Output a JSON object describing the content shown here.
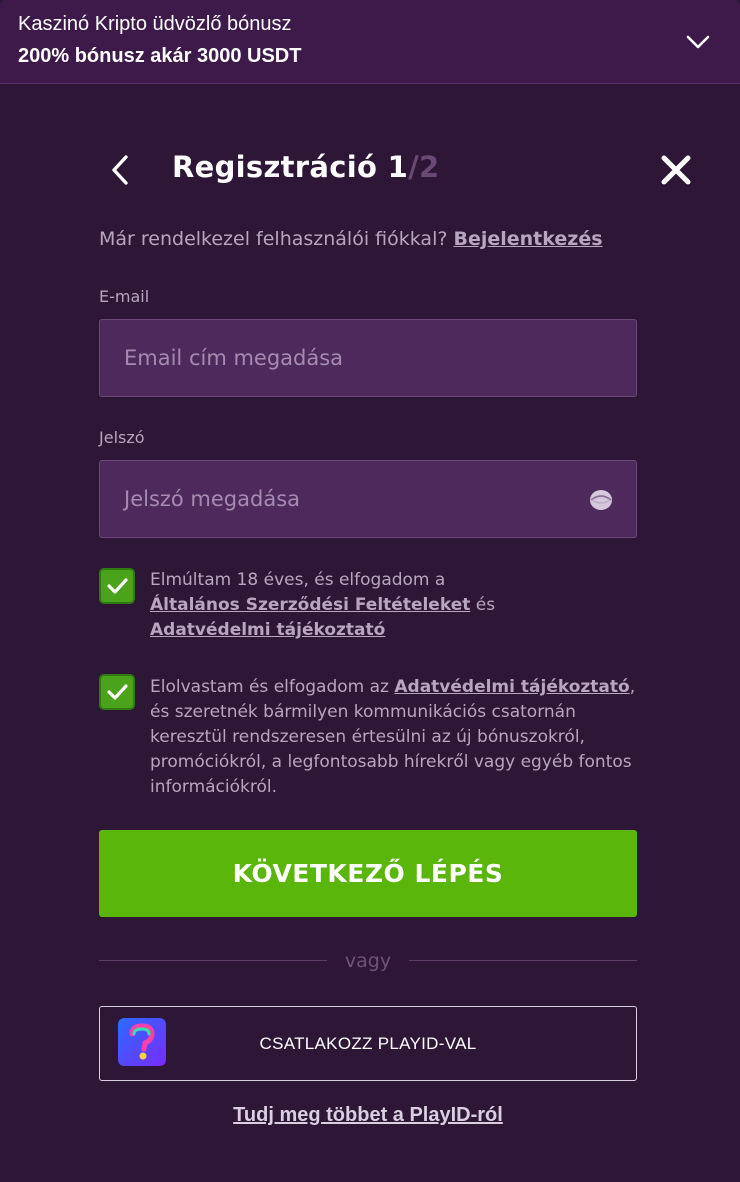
{
  "banner": {
    "title": "Kaszinó Kripto üdvözlő bónusz",
    "subtitle": "200% bónusz akár 3000 USDT",
    "toggle_icon": "chevron-down-icon"
  },
  "header": {
    "title": "Regisztráció 1",
    "step_total": "/2",
    "back_icon": "chevron-left-icon",
    "close_icon": "close-icon"
  },
  "login_prompt": {
    "text": "Már rendelkezel felhasználói fiókkal?",
    "link": "Bejelentkezés"
  },
  "email": {
    "label": "E-mail",
    "placeholder": "Email cím megadása",
    "value": ""
  },
  "password": {
    "label": "Jelszó",
    "placeholder": "Jelszó megadása",
    "value": "",
    "toggle_icon": "eye-icon"
  },
  "consents": [
    {
      "checked": true,
      "text_1": "Elmúltam 18 éves, és elfogadom a",
      "link_1": "Általános Szerződési Feltételeket",
      "text_2": " és",
      "link_2": "Adatvédelmi tájékoztató"
    },
    {
      "checked": true,
      "text_1": "Elolvastam és elfogadom az ",
      "link_1": "Adatvédelmi tájékoztató",
      "text_2": ", és szeretnék bármilyen kommunikációs csatornán keresztül rendszeresen értesülni az új bónuszokról, promóciókról, a legfontosabb hírekről vagy egyéb fontos információkról."
    }
  ],
  "next_button": "KÖVETKEZŐ LÉPÉS",
  "divider": "vagy",
  "playid_button": "CSATLAKOZZ PLAYID-VAL",
  "learn_more": "Tudj meg többet a PlayID-ról",
  "colors": {
    "background": "#2d1636",
    "banner": "#3d1a4a",
    "input_bg": "#4e2a5c",
    "accent_green": "#5ab60a",
    "muted_text": "#b8a6c0"
  }
}
